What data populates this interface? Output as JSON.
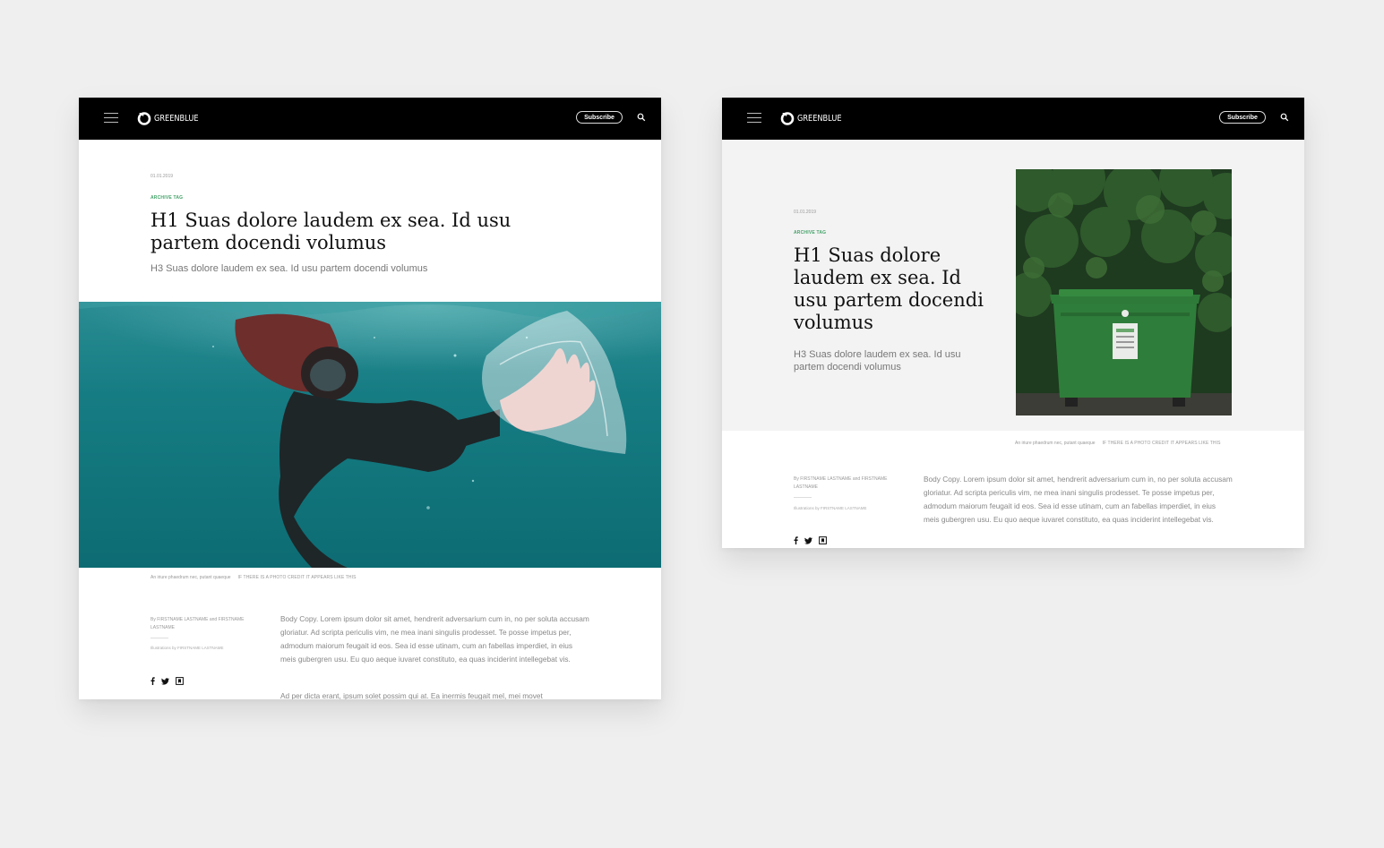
{
  "brand": {
    "name": "GREENBLUE",
    "accent_color": "#45a26a",
    "nav_background": "#000000",
    "canvas_background": "#efefef"
  },
  "nav": {
    "menu_icon": "hamburger-menu-icon",
    "logo_icon": "greenblue-logo-icon",
    "subscribe_label": "Subscribe",
    "search_icon": "search-icon"
  },
  "article_left": {
    "date": "01.01.2019",
    "tag": "ARCHIVE TAG",
    "h1": "H1 Suas dolore laudem ex sea. Id usu partem docendi volumus",
    "h3": "H3 Suas dolore laudem ex sea. Id usu partem docendi volumus",
    "hero_image": "Snorkeler underwater reaching for a floating plastic bag",
    "caption": "An iriure phaedrum nec, putant quaeque",
    "credit": "IF THERE IS A PHOTO CREDIT IT APPEARS LIKE THIS",
    "byline": "By FIRSTNAME LASTNAME and FIRSTNAME LASTNAME",
    "illustrations": "Illustrations by FIRSTNAME LASTNAME",
    "social": [
      "facebook-icon",
      "twitter-icon",
      "bookmark-icon"
    ],
    "body": "Body Copy. Lorem ipsum dolor sit amet, hendrerit adversarium cum in, no per soluta accusam gloriatur. Ad scripta periculis vim, ne mea inani singulis prodesset. Te posse impetus per, admodum maiorum feugait id eos. Sea id esse utinam, cum an fabellas imperdiet, in eius meis gubergren usu. Eu quo aeque iuvaret constituto, ea quas inciderint intellegebat vis.",
    "body2": "Ad per dicta erant, ipsum solet possim qui at. Ea inermis feugait mel, mei movet"
  },
  "article_right": {
    "date": "01.01.2019",
    "tag": "ARCHIVE TAG",
    "h1": "H1 Suas dolore laudem ex sea. Id usu partem docendi volumus",
    "h3": "H3 Suas dolore laudem ex sea. Id usu partem docendi volumus",
    "side_image": "Green wheelie recycling bin in front of dense green bushes",
    "caption": "An iriure phaedrum nec, putant quaeque",
    "credit": "IF THERE IS A PHOTO CREDIT IT APPEARS LIKE THIS",
    "byline": "By FIRSTNAME LASTNAME and FIRSTNAME LASTNAME",
    "illustrations": "Illustrations by FIRSTNAME LASTNAME",
    "social": [
      "facebook-icon",
      "twitter-icon",
      "bookmark-icon"
    ],
    "body": "Body Copy. Lorem ipsum dolor sit amet, hendrerit adversarium cum in, no per soluta accusam gloriatur. Ad scripta periculis vim, ne mea inani singulis prodesset. Te posse impetus per, admodum maiorum feugait id eos. Sea id esse utinam, cum an fabellas imperdiet, in eius meis gubergren usu. Eu quo aeque iuvaret constituto, ea quas inciderint intellegebat vis."
  }
}
